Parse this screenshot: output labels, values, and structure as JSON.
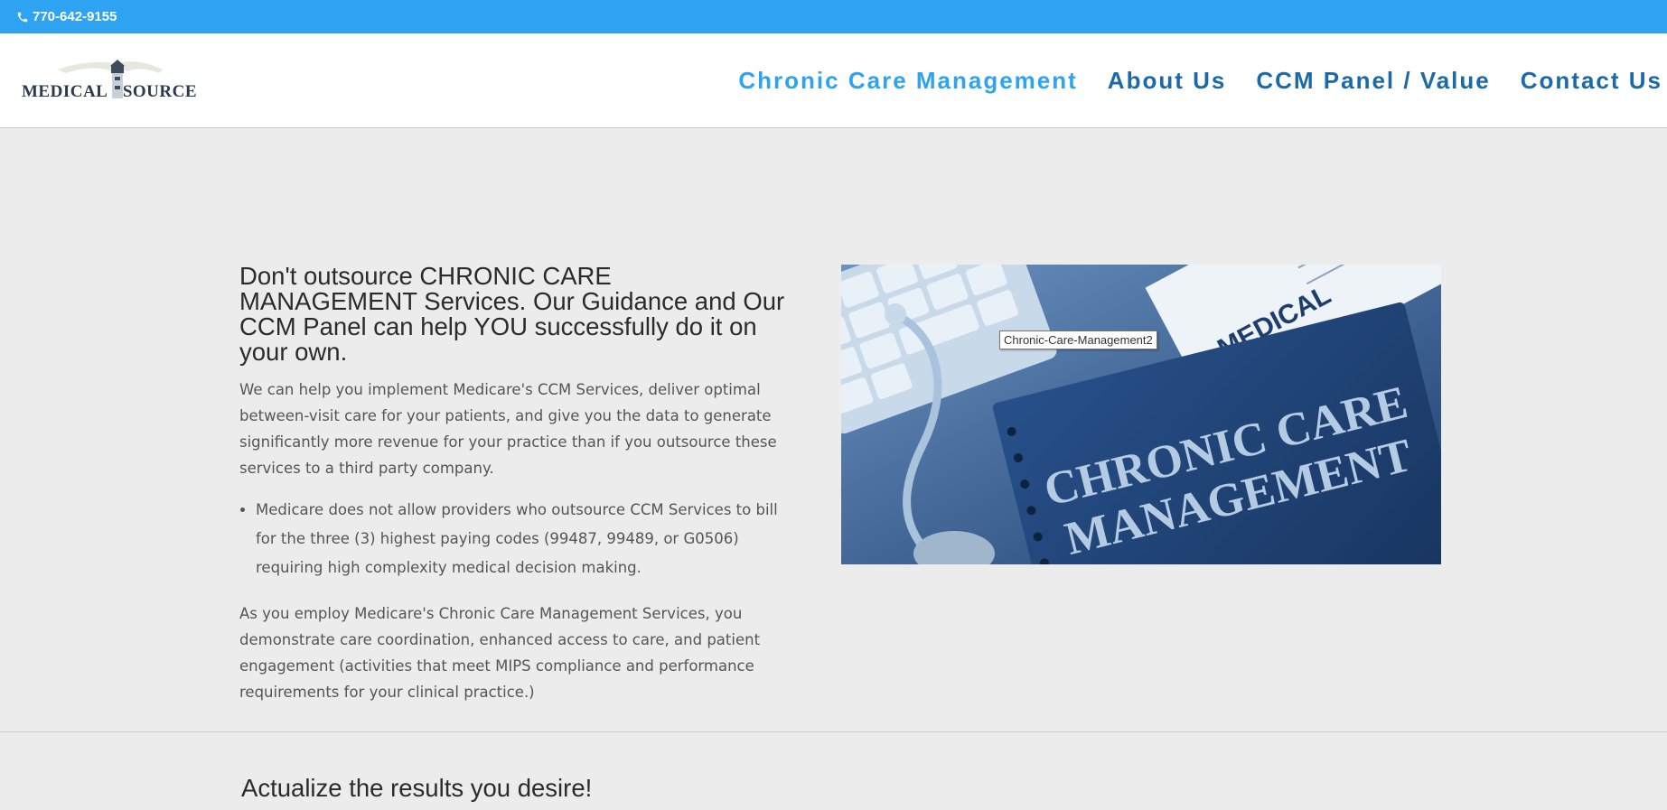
{
  "topbar": {
    "phone": "770-642-9155",
    "icon": "phone-icon"
  },
  "logo": {
    "left": "MEDICAL",
    "right": "SOURCE"
  },
  "nav": {
    "items": [
      {
        "label": "Chronic Care Management"
      },
      {
        "label": "About Us"
      },
      {
        "label": "CCM Panel / Value"
      },
      {
        "label": "Contact Us"
      }
    ]
  },
  "content": {
    "headline": "Don't outsource CHRONIC CARE MANAGEMENT Services. Our Guidance and Our CCM Panel can help YOU successfully do it on your own.",
    "intro": "We can help you implement Medicare's CCM Services, deliver optimal between-visit care for your patients, and give you the data to generate significantly more revenue for your practice than if you outsource these services to a third party company.",
    "bullets": [
      "Medicare does not allow providers who outsource CCM Services to bill for the three (3) highest paying codes (99487, 99489, or G0506) requiring high complexity medical decision making."
    ],
    "closing": "As you employ Medicare's Chronic Care Management Services, you demonstrate care coordination, enhanced access to care, and patient engagement (activities that meet MIPS compliance and performance requirements for your clinical practice.)"
  },
  "hero": {
    "line1": "CHRONIC CARE",
    "line2": "MANAGEMENT",
    "paper_label": "MEDICAL",
    "tooltip": "Chronic-Care-Management2"
  },
  "section2": {
    "headline": "Actualize the results you desire!"
  },
  "colors": {
    "topbar": "#2ea3f2",
    "nav_active": "#2ea3f2",
    "nav": "#1a6aaa",
    "background": "#ececec"
  }
}
